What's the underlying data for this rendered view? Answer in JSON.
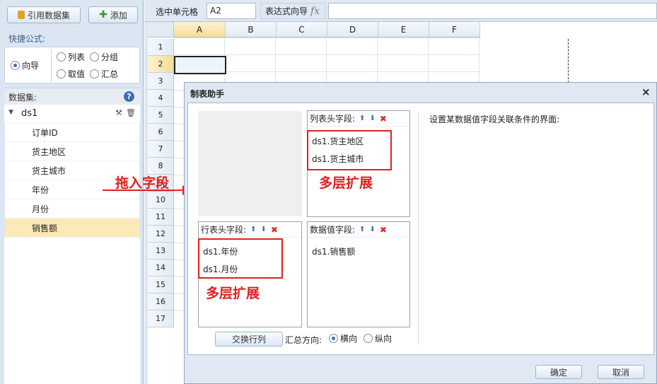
{
  "left_panel": {
    "ref_dataset_button": "引用数据集",
    "add_button": "添加",
    "quick_formula_label": "快捷公式:",
    "quick_formula_options": [
      "向导",
      "列表",
      "分组",
      "取值",
      "汇总"
    ],
    "quick_formula_selected": "向导",
    "dataset_label": "数据集:",
    "help_icon_glyph": "?",
    "dataset_name": "ds1",
    "fields": [
      "订单ID",
      "货主地区",
      "货主城市",
      "年份",
      "月份",
      "销售额"
    ],
    "selected_field": "销售额"
  },
  "toolbar": {
    "selected_cell_label": "选中单元格",
    "selected_cell_value": "A2",
    "expr_wizard_label": "表达式向导",
    "fx_glyph": "fx",
    "expr_value": ""
  },
  "grid": {
    "columns": [
      "A",
      "B",
      "C",
      "D",
      "E",
      "F"
    ],
    "rows": [
      "1",
      "2",
      "3",
      "4",
      "5",
      "6",
      "7",
      "8",
      "9",
      "10",
      "11",
      "12",
      "13",
      "14",
      "15",
      "16",
      "17"
    ],
    "selected_cell": "A2"
  },
  "annotations": {
    "drag_in": "拖入字段",
    "multi_level_1": "多层扩展",
    "multi_level_2": "多层扩展"
  },
  "dialog": {
    "title": "制表助手",
    "close_glyph": "×",
    "col_header_label": "列表头字段:",
    "col_header_fields": [
      "ds1.货主地区",
      "ds1.货主城市"
    ],
    "row_header_label": "行表头字段:",
    "row_header_fields": [
      "ds1.年份",
      "ds1.月份"
    ],
    "value_label": "数据值字段:",
    "value_fields": [
      "ds1.销售额"
    ],
    "description": "设置某数据值字段关联条件的界面:",
    "swap_button": "交换行列",
    "summary_direction_label": "汇总方向:",
    "direction_options": [
      "横向",
      "纵向"
    ],
    "direction_selected": "横向",
    "ok_button": "确定",
    "cancel_button": "取消"
  },
  "colors": {
    "accent_red": "#e02020",
    "selected_bg": "#fde9b8",
    "panel_bg": "#dce6f2"
  }
}
